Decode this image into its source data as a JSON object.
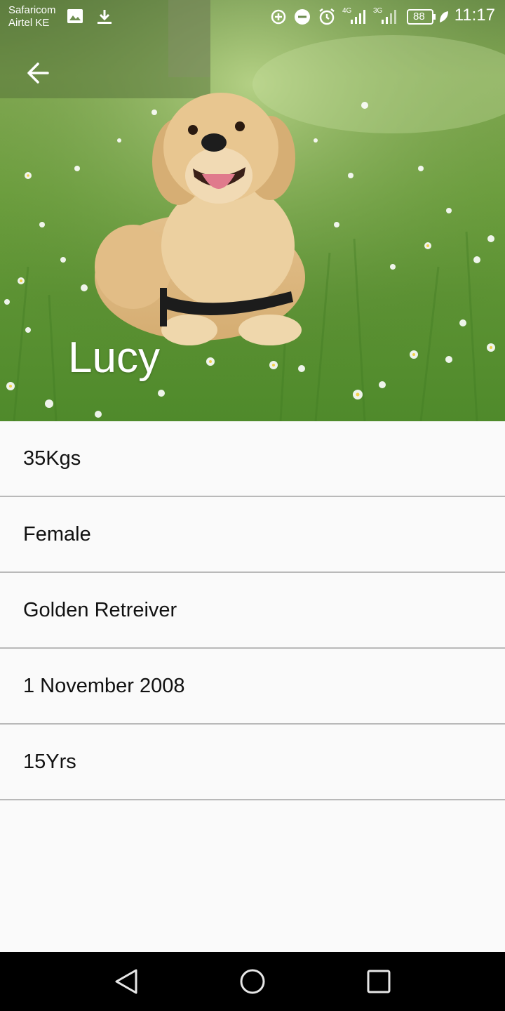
{
  "status_bar": {
    "carrier_1": "Safaricom",
    "carrier_2": "Airtel KE",
    "net_1": "4G",
    "net_2": "3G",
    "battery": "88",
    "time": "11:17",
    "icons": [
      "image-icon",
      "download-icon",
      "data-saver-icon",
      "do-not-disturb-icon",
      "alarm-icon",
      "signal-icon",
      "battery-icon",
      "leaf-icon"
    ]
  },
  "header": {
    "back_icon": "arrow-back-icon",
    "pet_name": "Lucy"
  },
  "details": [
    {
      "value": "35Kgs"
    },
    {
      "value": "Female"
    },
    {
      "value": "Golden Retreiver"
    },
    {
      "value": "1 November 2008"
    },
    {
      "value": "15Yrs"
    }
  ],
  "nav_bar": {
    "icons": [
      "back-triangle-icon",
      "home-circle-icon",
      "recents-square-icon"
    ]
  },
  "colors": {
    "background": "#fafafa",
    "divider": "#b9b9b9",
    "text": "#111111",
    "navbar": "#000000"
  }
}
